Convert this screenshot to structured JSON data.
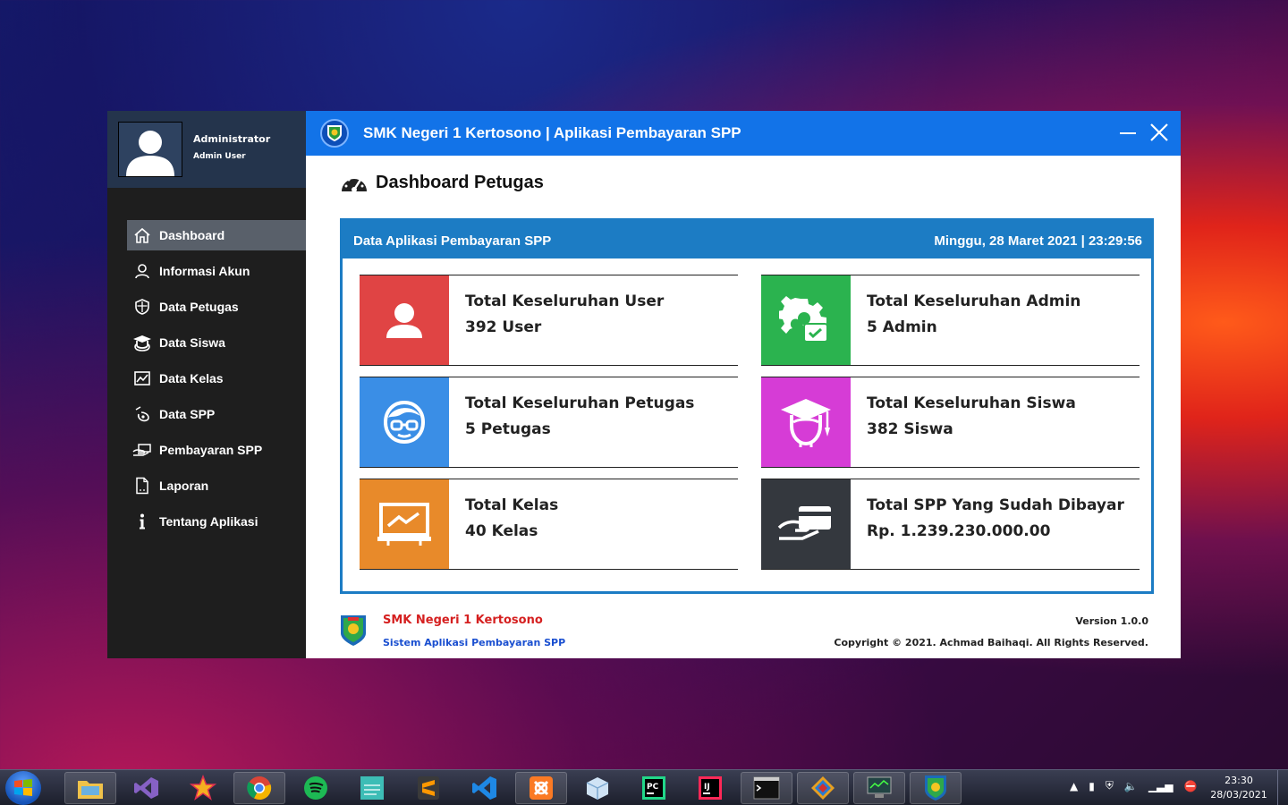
{
  "sidebar": {
    "user_name": "Administrator",
    "user_role": "Admin User",
    "items": [
      {
        "label": "Dashboard",
        "icon": "home-icon",
        "active": true
      },
      {
        "label": "Informasi Akun",
        "icon": "user-icon"
      },
      {
        "label": "Data Petugas",
        "icon": "shield-icon"
      },
      {
        "label": "Data Siswa",
        "icon": "graduate-icon"
      },
      {
        "label": "Data Kelas",
        "icon": "chart-icon"
      },
      {
        "label": "Data SPP",
        "icon": "money-icon"
      },
      {
        "label": "Pembayaran SPP",
        "icon": "payment-icon"
      },
      {
        "label": "Laporan",
        "icon": "document-icon"
      },
      {
        "label": "Tentang Aplikasi",
        "icon": "info-icon"
      }
    ]
  },
  "header": {
    "title": "SMK Negeri 1 Kertosono | Aplikasi Pembayaran SPP"
  },
  "page": {
    "title": "Dashboard Petugas"
  },
  "panel": {
    "title": "Data Aplikasi Pembayaran SPP",
    "datetime": "Minggu, 28 Maret 2021 | 23:29:56"
  },
  "cards": [
    {
      "title": "Total Keseluruhan User",
      "value": "392 User",
      "color": "#e04444",
      "icon": "user-icon"
    },
    {
      "title": "Total Keseluruhan Admin",
      "value": "5 Admin",
      "color": "#2bb34f",
      "icon": "admin-gear-icon"
    },
    {
      "title": "Total Keseluruhan Petugas",
      "value": "5 Petugas",
      "color": "#3a8ee6",
      "icon": "officer-icon"
    },
    {
      "title": "Total Keseluruhan Siswa",
      "value": "382 Siswa",
      "color": "#d63cd6",
      "icon": "graduate-icon"
    },
    {
      "title": "Total Kelas",
      "value": "40 Kelas",
      "color": "#e88a2a",
      "icon": "classroom-chart-icon"
    },
    {
      "title": "Total SPP Yang Sudah Dibayar",
      "value": "Rp. 1.239.230.000.00",
      "color": "#34383e",
      "icon": "card-payment-icon"
    }
  ],
  "footer": {
    "school": "SMK Negeri 1 Kertosono",
    "app": "Sistem Aplikasi Pembayaran SPP",
    "version": "Version 1.0.0",
    "copyright": "Copyright © 2021. Achmad Baihaqi. All Rights Reserved."
  },
  "taskbar": {
    "apps": [
      "file-explorer",
      "visual-studio",
      "star-app",
      "chrome",
      "spotify",
      "android-studio",
      "sublime-text",
      "vs-code",
      "xampp",
      "virtualbox",
      "pycharm",
      "intellij",
      "command-prompt",
      "snipping-tool",
      "task-manager",
      "spp-app"
    ],
    "time": "23:30",
    "date": "28/03/2021"
  }
}
